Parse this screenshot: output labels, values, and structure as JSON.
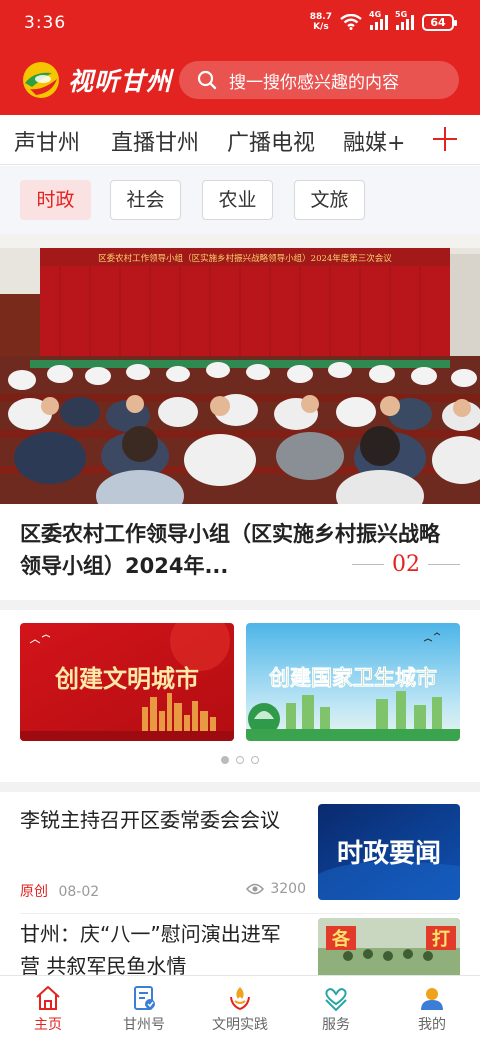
{
  "status_bar": {
    "time": "3:36",
    "net_speed_value": "88.7",
    "net_speed_unit": "K/s",
    "signal1_label": "4G",
    "signal2_label": "5G",
    "battery": "64"
  },
  "header": {
    "app_name": "视听甘州",
    "search_placeholder": "搜一搜你感兴趣的内容"
  },
  "channels": {
    "items": [
      {
        "label": "声甘州"
      },
      {
        "label": "直播甘州"
      },
      {
        "label": "广播电视"
      },
      {
        "label": "融媒+"
      }
    ]
  },
  "subtabs": {
    "items": [
      {
        "label": "时政",
        "active": true
      },
      {
        "label": "社会"
      },
      {
        "label": "农业"
      },
      {
        "label": "文旅"
      }
    ]
  },
  "hero": {
    "banner_text": "区委农村工作领导小组（区实施乡村振兴战略领导小组）2024年度第三次会议",
    "title": "区委农村工作领导小组（区实施乡村振兴战略　领导小组）2024年...",
    "index": "02"
  },
  "banners": {
    "items": [
      {
        "text": "创建文明城市"
      },
      {
        "text": "创建国家卫生城市"
      }
    ],
    "active_dot": 0
  },
  "news": {
    "items": [
      {
        "title": "李锐主持召开区委常委会会议",
        "tag": "原创",
        "date": "08-02",
        "views": "3200",
        "thumb_text": "时政要闻"
      },
      {
        "title": "甘州：庆“八一”慰问演出进军营 共叙军民鱼水情",
        "thumb_text_left": "各",
        "thumb_text_right": "打"
      }
    ]
  },
  "tabbar": {
    "items": [
      {
        "label": "主页",
        "icon": "home-icon",
        "active": true
      },
      {
        "label": "甘州号",
        "icon": "document-icon"
      },
      {
        "label": "文明实践",
        "icon": "torch-icon"
      },
      {
        "label": "服务",
        "icon": "heart-hands-icon"
      },
      {
        "label": "我的",
        "icon": "user-icon"
      }
    ]
  },
  "colors": {
    "brand_red": "#e3231f",
    "active_tab_bg": "#fbe2e2",
    "muted_text": "#9a9a9a"
  }
}
